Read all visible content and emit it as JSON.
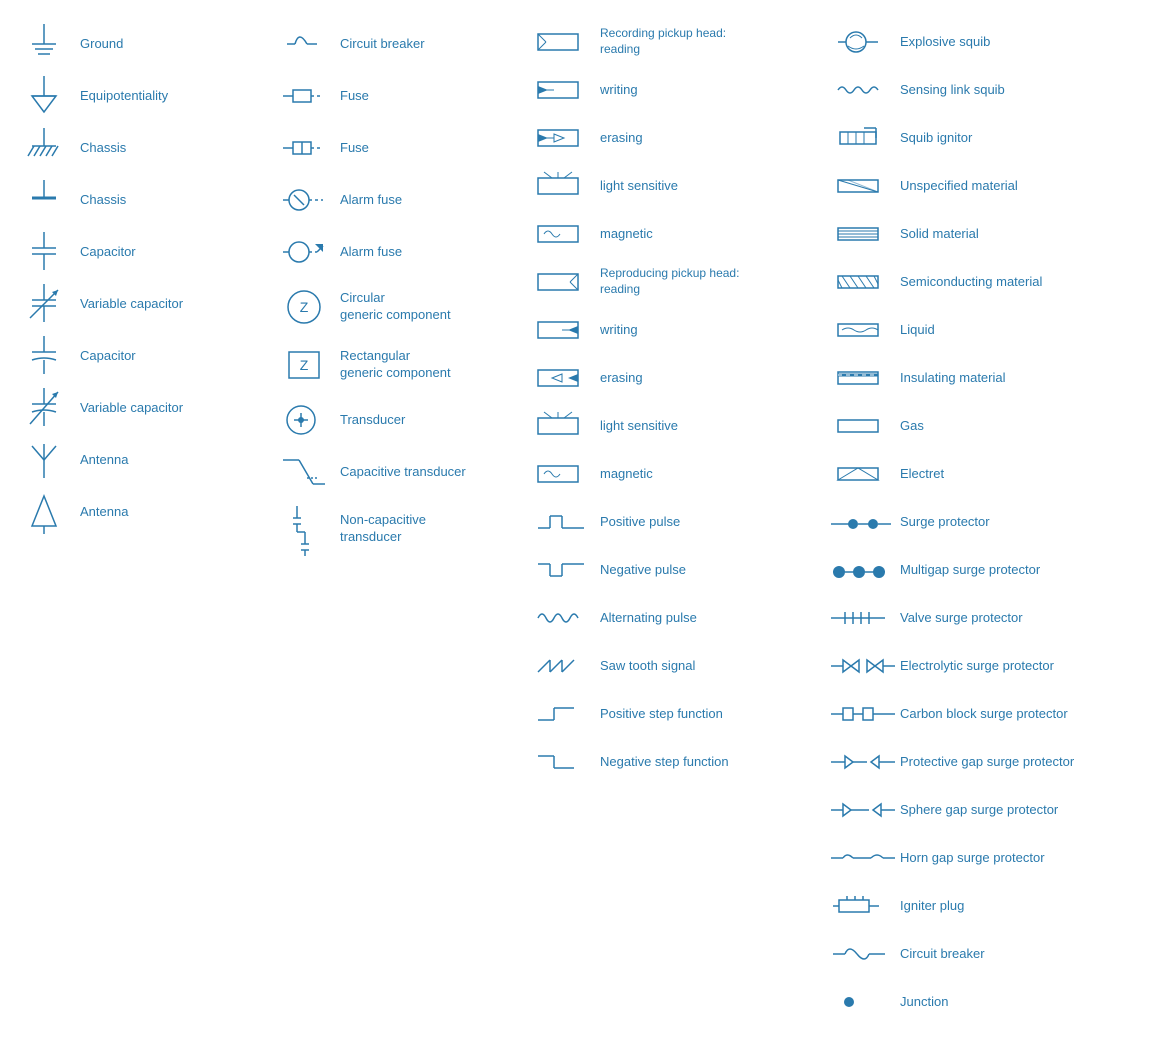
{
  "items": {
    "col1": [
      {
        "name": "ground",
        "label": "Ground"
      },
      {
        "name": "equipotentiality",
        "label": "Equipotentiality"
      },
      {
        "name": "chassis1",
        "label": "Chassis"
      },
      {
        "name": "chassis2",
        "label": "Chassis"
      },
      {
        "name": "capacitor1",
        "label": "Capacitor"
      },
      {
        "name": "variable-capacitor1",
        "label": "Variable capacitor"
      },
      {
        "name": "capacitor2",
        "label": "Capacitor"
      },
      {
        "name": "variable-capacitor2",
        "label": "Variable capacitor"
      },
      {
        "name": "antenna1",
        "label": "Antenna"
      },
      {
        "name": "antenna2",
        "label": "Antenna"
      }
    ],
    "col2": [
      {
        "name": "circuit-breaker",
        "label": "Circuit breaker"
      },
      {
        "name": "fuse1",
        "label": "Fuse"
      },
      {
        "name": "fuse2",
        "label": "Fuse"
      },
      {
        "name": "alarm-fuse1",
        "label": "Alarm fuse"
      },
      {
        "name": "alarm-fuse2",
        "label": "Alarm fuse"
      },
      {
        "name": "circular-generic",
        "label": "Circular\ngeneric component"
      },
      {
        "name": "rectangular-generic",
        "label": "Rectangular\ngeneric component"
      },
      {
        "name": "transducer",
        "label": "Transducer"
      },
      {
        "name": "capacitive-transducer",
        "label": "Capacitive transducer"
      },
      {
        "name": "non-capacitive-transducer",
        "label": "Non-capacitive\ntransducer"
      }
    ],
    "col3": [
      {
        "name": "recording-reading",
        "label": "Recording pickup head:\nreading"
      },
      {
        "name": "recording-writing",
        "label": "writing"
      },
      {
        "name": "recording-erasing",
        "label": "erasing"
      },
      {
        "name": "recording-light-sensitive",
        "label": "light sensitive"
      },
      {
        "name": "recording-magnetic",
        "label": "magnetic"
      },
      {
        "name": "reproducing-reading",
        "label": "Reproducing pickup head:\nreading"
      },
      {
        "name": "reproducing-writing",
        "label": "writing"
      },
      {
        "name": "reproducing-erasing",
        "label": "erasing"
      },
      {
        "name": "reproducing-light-sensitive",
        "label": "light sensitive"
      },
      {
        "name": "reproducing-magnetic",
        "label": "magnetic"
      },
      {
        "name": "positive-pulse",
        "label": "Positive pulse"
      },
      {
        "name": "negative-pulse",
        "label": "Negative pulse"
      },
      {
        "name": "alternating-pulse",
        "label": "Alternating pulse"
      },
      {
        "name": "saw-tooth",
        "label": "Saw tooth signal"
      },
      {
        "name": "positive-step",
        "label": "Positive step function"
      },
      {
        "name": "negative-step",
        "label": "Negative step function"
      }
    ],
    "col4": [
      {
        "name": "explosive-squib",
        "label": "Explosive squib"
      },
      {
        "name": "sensing-link-squib",
        "label": "Sensing link squib"
      },
      {
        "name": "squib-ignitor",
        "label": "Squib ignitor"
      },
      {
        "name": "unspecified-material",
        "label": "Unspecified material"
      },
      {
        "name": "solid-material",
        "label": "Solid material"
      },
      {
        "name": "semiconducting-material",
        "label": "Semiconducting material"
      },
      {
        "name": "liquid",
        "label": "Liquid"
      },
      {
        "name": "insulating-material",
        "label": "Insulating material"
      },
      {
        "name": "gas",
        "label": "Gas"
      },
      {
        "name": "electret",
        "label": "Electret"
      },
      {
        "name": "surge-protector",
        "label": "Surge protector"
      },
      {
        "name": "multigap-surge-protector",
        "label": "Multigap surge protector"
      },
      {
        "name": "valve-surge-protector",
        "label": "Valve surge protector"
      },
      {
        "name": "electrolytic-surge-protector",
        "label": "Electrolytic surge protector"
      },
      {
        "name": "carbon-block-surge-protector",
        "label": "Carbon block surge protector"
      },
      {
        "name": "protective-gap-surge-protector",
        "label": "Protective gap surge protector"
      },
      {
        "name": "sphere-gap-surge-protector",
        "label": "Sphere gap surge protector"
      },
      {
        "name": "horn-gap-surge-protector",
        "label": "Horn gap surge protector"
      },
      {
        "name": "igniter-plug",
        "label": "Igniter plug"
      },
      {
        "name": "circuit-breaker2",
        "label": "Circuit breaker"
      },
      {
        "name": "junction",
        "label": "Junction"
      }
    ]
  }
}
